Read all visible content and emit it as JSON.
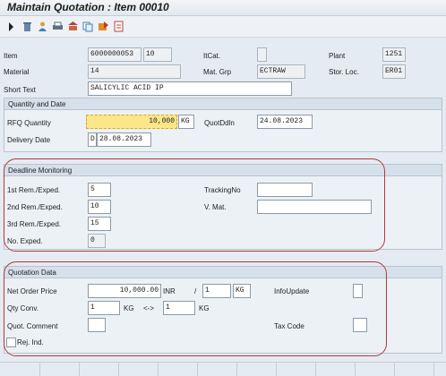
{
  "window": {
    "title": "Maintain Quotation : Item 00010"
  },
  "header": {
    "item_label": "Item",
    "item_value": "6000000053",
    "item_number": "10",
    "itcat_label": "ItCat.",
    "itcat_value": "",
    "plant_label": "Plant",
    "plant_value": "1251",
    "material_label": "Material",
    "material_value": "14",
    "matgrp_label": "Mat. Grp",
    "matgrp_value": "ECTRAW",
    "storloc_label": "Stor. Loc.",
    "storloc_value": "ER01",
    "shorttext_label": "Short Text",
    "shorttext_value": "SALICYLIC ACID IP"
  },
  "qty_section": {
    "title": "Quantity and Date",
    "rfq_label": "RFQ Quantity",
    "rfq_value": "10,000",
    "rfq_unit": "KG",
    "quotddln_label": "QuotDdln",
    "quotddln_value": "24.08.2023",
    "delivery_label": "Delivery Date",
    "delivery_prefix": "D",
    "delivery_value": "28.08.2023"
  },
  "deadline_section": {
    "title": "Deadline Monitoring",
    "rem1_label": "1st Rem./Exped.",
    "rem1_value": "5",
    "rem2_label": "2nd Rem./Exped.",
    "rem2_value": "10",
    "rem3_label": "3rd Rem./Exped.",
    "rem3_value": "15",
    "noexp_label": "No. Exped.",
    "noexp_value": "0",
    "tracking_label": "TrackingNo",
    "tracking_value": "",
    "vmat_label": "V. Mat.",
    "vmat_value": ""
  },
  "quotation_section": {
    "title": "Quotation Data",
    "netprice_label": "Net Order Price",
    "netprice_value": "10,000.00",
    "currency": "INR",
    "slash": "/",
    "per_value": "1",
    "per_unit": "KG",
    "infoupdate_label": "InfoUpdate",
    "infoupdate_value": "",
    "qtyconv_label": "Qty Conv.",
    "qtyconv_left": "1",
    "qtyconv_left_unit": "KG",
    "qtyconv_arrow": "<->",
    "qtyconv_right": "1",
    "qtyconv_right_unit": "KG",
    "comment_label": "Quot. Comment",
    "comment_value": "",
    "taxcode_label": "Tax Code",
    "taxcode_value": "",
    "rejind_label": "Rej. Ind."
  },
  "colors": {
    "highlight": "#fbe68a",
    "annotation_oval": "#b23a3a"
  },
  "toolbar_icons": [
    "execute-arrow-icon",
    "delete-icon",
    "person-icon",
    "print-icon",
    "bank-icon",
    "copy-icon",
    "export-icon",
    "document-icon"
  ]
}
